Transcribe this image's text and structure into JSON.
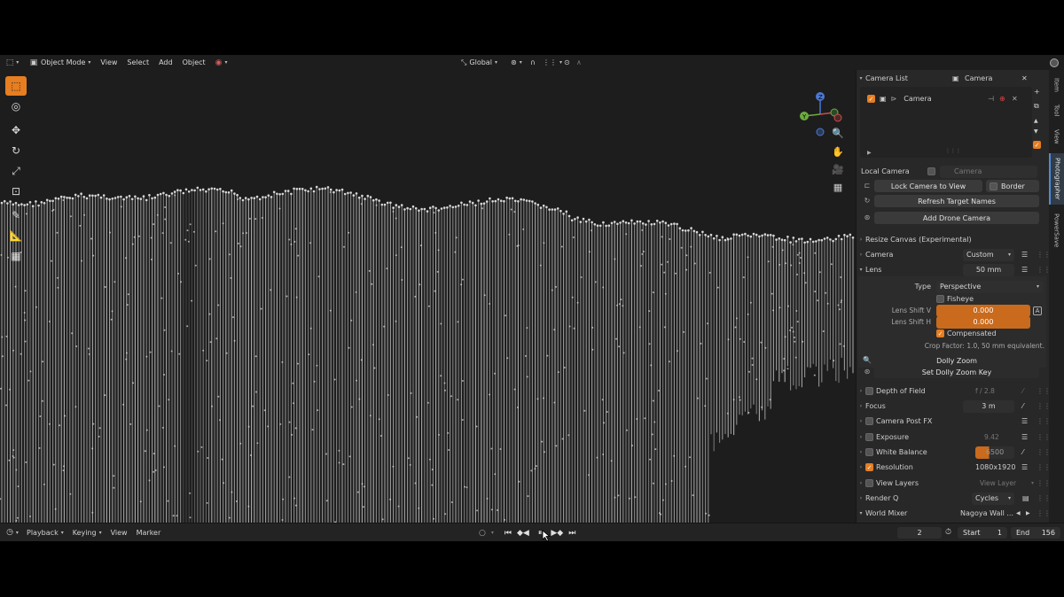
{
  "viewport_header": {
    "mode": "Object Mode",
    "menus": [
      "View",
      "Select",
      "Add",
      "Object"
    ],
    "orientation": "Global"
  },
  "navigation": {
    "zoom_label": "Zoom",
    "pan_label": "Pan",
    "camera_label": "Camera",
    "ortho_label": "Ortho"
  },
  "panel": {
    "camera_list_label": "Camera List",
    "camera_tab": "Camera",
    "camera_item": "Camera",
    "local_camera_label": "Local Camera",
    "local_camera_value": "Camera",
    "lock_camera_label": "Lock Camera to View",
    "border_label": "Border",
    "refresh_label": "Refresh Target Names",
    "add_drone_label": "Add Drone Camera",
    "resize_canvas_label": "Resize Canvas (Experimental)",
    "camera_section": "Camera",
    "camera_preset": "Custom",
    "lens_label": "Lens",
    "lens_value": "50 mm",
    "type_label": "Type",
    "type_value": "Perspective",
    "fisheye_label": "Fisheye",
    "lens_shift_v_label": "Lens Shift V",
    "lens_shift_v_value": "0.000",
    "lens_shift_h_label": "Lens Shift H",
    "lens_shift_h_value": "0.000",
    "compensated_label": "Compensated",
    "crop_factor": "Crop Factor: 1.0, 50 mm equivalent.",
    "dolly_zoom_label": "Dolly Zoom",
    "set_dolly_label": "Set Dolly Zoom Key",
    "dof_label": "Depth of Field",
    "dof_value": "f / 2.8",
    "focus_label": "Focus",
    "focus_value": "3 m",
    "post_fx_label": "Camera Post FX",
    "exposure_label": "Exposure",
    "exposure_value": "9.42",
    "white_balance_label": "White Balance",
    "white_balance_value": "6500",
    "resolution_label": "Resolution",
    "resolution_value": "1080x1920",
    "view_layers_label": "View Layers",
    "view_layers_value": "View Layer",
    "render_q_label": "Render Q",
    "render_q_value": "Cycles",
    "world_mixer_label": "World Mixer",
    "world_mixer_value": "Nagoya Wall ..."
  },
  "side_tabs": [
    "Item",
    "Tool",
    "View",
    "Photographer",
    "PowerSave"
  ],
  "timeline": {
    "playback_label": "Playback",
    "keying_label": "Keying",
    "view_label": "View",
    "marker_label": "Marker",
    "current_frame": "2",
    "start_label": "Start",
    "start_value": "1",
    "end_label": "End",
    "end_value": "156"
  },
  "colors": {
    "accent": "#e67e22",
    "background": "#1d1d1d",
    "panel": "#282828",
    "mesh": "#a0a0a0"
  }
}
